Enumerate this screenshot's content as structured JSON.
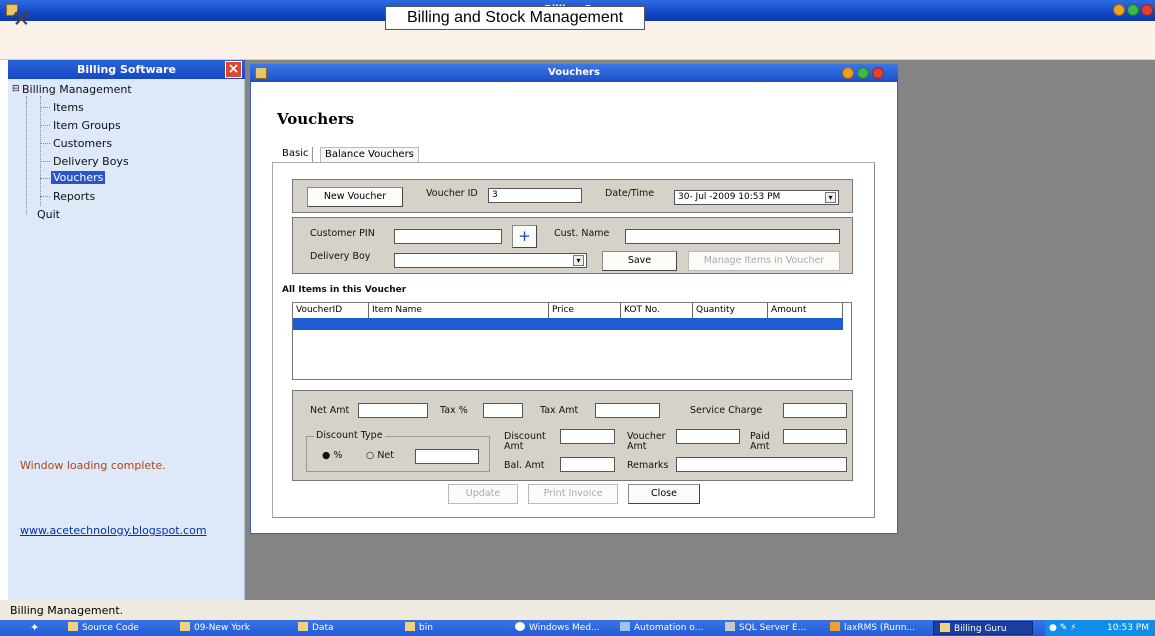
{
  "window": {
    "title": "Billing Guru"
  },
  "header": {
    "heading": "Billing and Stock Management"
  },
  "left_panel": {
    "title": "Billing Software",
    "tree": {
      "root": "Billing Management",
      "children": [
        "Items",
        "Item Groups",
        "Customers",
        "Delivery Boys",
        "Vouchers",
        "Reports"
      ],
      "selected": "Vouchers",
      "quit": "Quit"
    },
    "status_message": "Window loading complete.",
    "link": "www.acetechnology.blogspot.com"
  },
  "vouchers_window": {
    "title": "Vouchers",
    "heading": "Vouchers",
    "tabs": [
      "Basic",
      "Balance Vouchers"
    ],
    "top": {
      "new_voucher": "New Voucher",
      "voucher_id_label": "Voucher ID",
      "voucher_id_value": "3",
      "datetime_label": "Date/Time",
      "datetime_value": "30- Jul -2009 10:53 PM"
    },
    "customer": {
      "pin_label": "Customer PIN",
      "plus": "+",
      "name_label": "Cust. Name",
      "delivery_label": "Delivery Boy",
      "save": "Save",
      "manage_items": "Manage Items in Voucher"
    },
    "items_heading": "All Items in this Voucher",
    "grid_columns": [
      "VoucherID",
      "Item Name",
      "Price",
      "KOT No.",
      "Quantity",
      "Amount"
    ],
    "totals": {
      "net_amt": "Net Amt",
      "tax_pct": "Tax %",
      "tax_amt": "Tax Amt",
      "service_charge": "Service Charge",
      "discount_type": "Discount Type",
      "percent": "%",
      "net": "Net",
      "discount_amt_1": "Discount",
      "discount_amt_2": "Amt",
      "voucher_amt_1": "Voucher",
      "voucher_amt_2": "Amt",
      "paid_amt_1": "Paid",
      "paid_amt_2": "Amt",
      "bal_amt": "Bal. Amt",
      "remarks": "Remarks"
    },
    "buttons": {
      "update": "Update",
      "print": "Print Invoice",
      "close": "Close"
    }
  },
  "statusbar": {
    "text": "Billing Management."
  },
  "taskbar": {
    "tasks": [
      "Source Code",
      "09-New York",
      "Data",
      "bin",
      "Windows Med...",
      "Automation o...",
      "SQL Server E...",
      "laxRMS (Runn...",
      "Billing Guru"
    ],
    "clock": "10:53 PM"
  }
}
